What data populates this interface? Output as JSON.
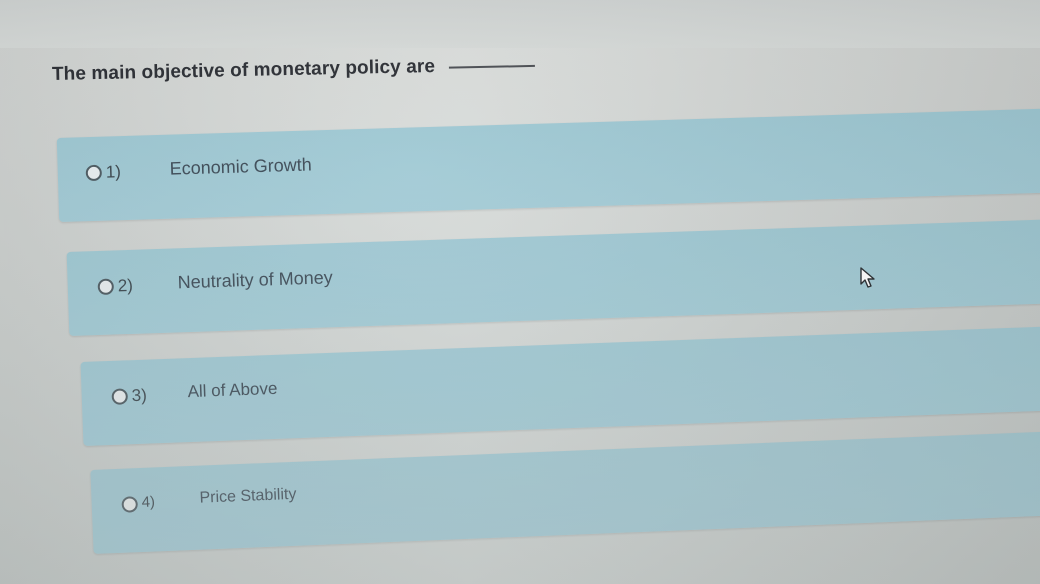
{
  "question": {
    "text": "The main objective of monetary policy are"
  },
  "options": [
    {
      "number": "1)",
      "label": "Economic Growth"
    },
    {
      "number": "2)",
      "label": "Neutrality of Money"
    },
    {
      "number": "3)",
      "label": "All of Above"
    },
    {
      "number": "4)",
      "label": "Price Stability"
    }
  ],
  "colors": {
    "option_background": "#9ec8d3",
    "page_background": "#d6dad8",
    "question_text": "#2a2d33",
    "option_text": "#3d4b57"
  },
  "icons": {
    "cursor": "mouse-pointer-icon",
    "radio": "radio-button-icon"
  }
}
